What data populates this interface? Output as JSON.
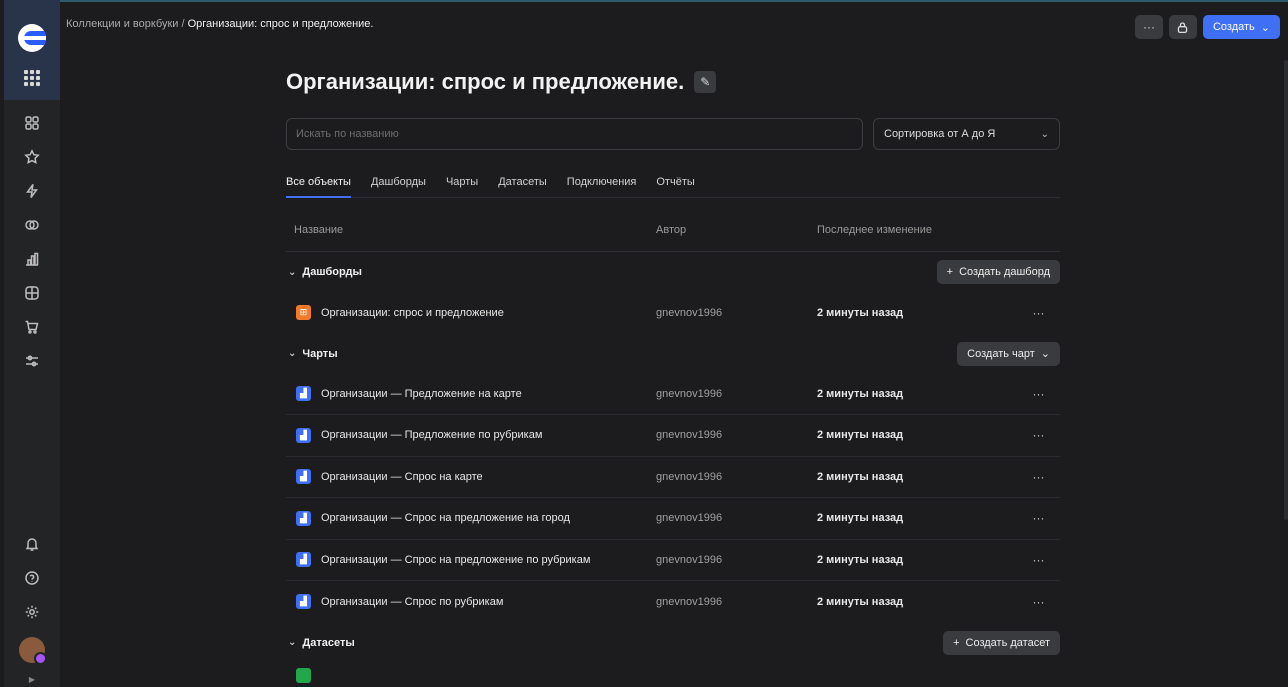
{
  "breadcrumb": {
    "parent": "Коллекции и воркбуки",
    "separator": " / ",
    "current": "Организации: спрос и предложение."
  },
  "topbar": {
    "more_label": "···",
    "create_label": "Создать"
  },
  "page": {
    "title": "Организации: спрос и предложение."
  },
  "search": {
    "placeholder": "Искать по названию"
  },
  "sort": {
    "label": "Сортировка от А до Я"
  },
  "tabs": [
    "Все объекты",
    "Дашборды",
    "Чарты",
    "Датасеты",
    "Подключения",
    "Отчёты"
  ],
  "table_headers": {
    "name": "Название",
    "author": "Автор",
    "date": "Последнее изменение"
  },
  "sections": {
    "dashboards": {
      "title": "Дашборды",
      "button": "Создать дашборд",
      "rows": [
        {
          "name": "Организации: спрос и предложение",
          "author": "gnevnov1996",
          "date": "2 минуты назад"
        }
      ]
    },
    "charts": {
      "title": "Чарты",
      "button": "Создать чарт",
      "rows": [
        {
          "name": "Организации — Предложение на карте",
          "author": "gnevnov1996",
          "date": "2 минуты назад"
        },
        {
          "name": "Организации — Предложение по рубрикам",
          "author": "gnevnov1996",
          "date": "2 минуты назад"
        },
        {
          "name": "Организации — Спрос на карте",
          "author": "gnevnov1996",
          "date": "2 минуты назад"
        },
        {
          "name": "Организации — Спрос на предложение на город",
          "author": "gnevnov1996",
          "date": "2 минуты назад"
        },
        {
          "name": "Организации — Спрос на предложение по рубрикам",
          "author": "gnevnov1996",
          "date": "2 минуты назад"
        },
        {
          "name": "Организации — Спрос по рубрикам",
          "author": "gnevnov1996",
          "date": "2 минуты назад"
        }
      ]
    },
    "datasets": {
      "title": "Датасеты",
      "button": "Создать датасет"
    }
  },
  "row_more": "···",
  "colors": {
    "accent": "#3e6ff5",
    "dashboard_icon": "#f07b2b",
    "chart_icon": "#3e6ff5"
  }
}
